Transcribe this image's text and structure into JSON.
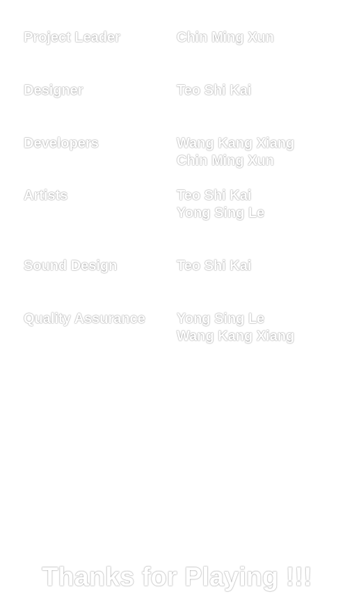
{
  "credits": [
    {
      "role": "Project Leader",
      "names": [
        "Chin Ming Xun"
      ]
    },
    {
      "role": "Designer",
      "names": [
        "Teo Shi Kai"
      ]
    },
    {
      "role": "Developers",
      "names": [
        "Wang Kang Xiang",
        "Chin Ming Xun"
      ]
    },
    {
      "role": "Artists",
      "names": [
        "Teo Shi Kai",
        "Yong Sing Le"
      ]
    },
    {
      "role": "Sound Design",
      "names": [
        "Teo Shi Kai"
      ]
    },
    {
      "role": "Quality Assurance",
      "names": [
        "Yong Sing Le",
        "Wang Kang Xiang"
      ]
    }
  ],
  "thanks": "Thanks for Playing !!!"
}
